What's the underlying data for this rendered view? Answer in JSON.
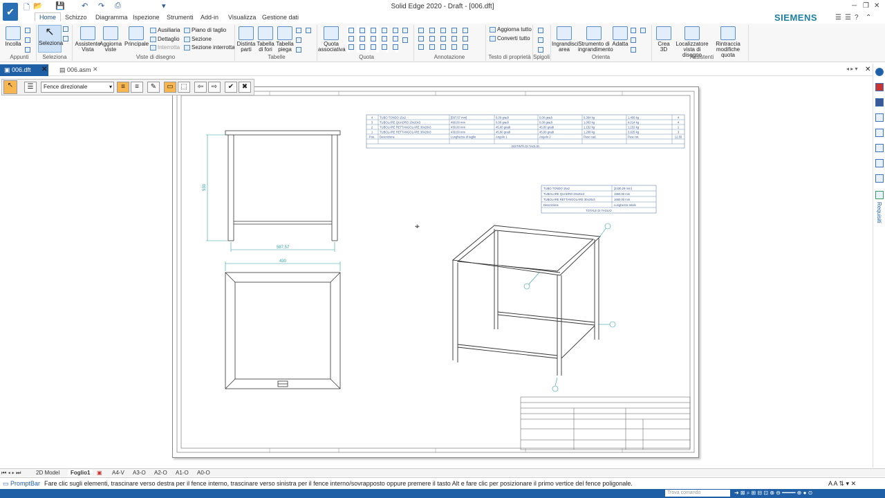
{
  "window": {
    "title": "Solid Edge 2020 - Draft - [006.dft]"
  },
  "ribbon_tabs": [
    "Home",
    "Schizzo",
    "Diagramma",
    "Ispezione",
    "Strumenti",
    "Add-in",
    "Visualizza",
    "Gestione dati"
  ],
  "brand": "SIEMENS",
  "ribbon": {
    "incolla": "Incolla",
    "seleziona": "Seleziona",
    "assistente_vista": "Assistente Vista",
    "aggiorna_viste": "Aggiorna viste",
    "principale": "Principale",
    "ausiliaria": "Ausiliaria",
    "dettaglio": "Dettaglio",
    "interrotta": "Interrotta",
    "piano_di_taglio": "Piano di taglio",
    "sezione": "Sezione",
    "sezione_interrotta": "Sezione interrotta",
    "distinta_parti": "Distinta parti",
    "tabella_di_fori": "Tabella di fori",
    "tabella_piega": "Tabella piega",
    "quota_associativa": "Quota associativa",
    "aggiorna_tutto": "Aggiorna tutto",
    "converti_tutto": "Converti tutto",
    "ingrandisci_area": "Ingrandisci area",
    "strumento_ingrandimento": "Strumento di ingrandimento",
    "adatta": "Adatta",
    "crea_3d": "Crea 3D",
    "localizzatore": "Localizzatore vista di disegno",
    "rintraccia": "Rintraccia modifiche quota",
    "groups": [
      "Appunti",
      "Seleziona",
      "Viste di disegno",
      "Tabelle",
      "Quota",
      "Annotazione",
      "Testo di proprietà",
      "Spigoli",
      "Orienta",
      "Assistenti"
    ]
  },
  "doc_tabs": [
    "006.dft",
    "006.asm"
  ],
  "command_bar": {
    "fence_option": "Fence direzionale"
  },
  "right_panel": {
    "label": "Requisiti"
  },
  "sheet_tabs": [
    "2D Model",
    "Foglio1",
    "A4-V",
    "A3-O",
    "A2-O",
    "A1-O",
    "A0-O"
  ],
  "prompt": {
    "label": "PromptBar",
    "text": "Fare clic sugli elementi, trascinare verso destra per il fence interno, trascinare verso sinistra per il fence interno/sovrapposto oppure premere il tasto Alt e fare clic per posizionare il primo vertice del fence poligonale."
  },
  "status": {
    "search_placeholder": "Trova comando"
  },
  "drawing": {
    "cut_table_1": {
      "rows": [
        [
          "4",
          "TUBO TONDO 15x2",
          "[587,57 mm]",
          "0,00 gradi",
          "0,00 gradi",
          "0,364 kg",
          "1,456 kg",
          "4"
        ],
        [
          "3",
          "TUBOLARE QUADRO 20x20x3",
          "490,00 mm",
          "0,00 gradi",
          "0,00 gradi",
          "1,003 kg",
          "4,014 kg",
          "4"
        ],
        [
          "2",
          "TUBOLARE RETTANGOLARE 30x20x3",
          "430,00 mm",
          "45,00 gradi",
          "45,00 gradi",
          "1,152 kg",
          "1,152 kg",
          "1"
        ],
        [
          "1",
          "TUBOLARE RETTANGOLARE 30x20x3",
          "430,00 mm",
          "45,00 gradi",
          "45,00 gradi",
          "1,208 kg",
          "3,625 kg",
          "3"
        ],
        [
          "Pos.",
          "Descrizione",
          "Lunghezza di taglio",
          "Angolo 1",
          "Angolo 2",
          "Peso cad.",
          "Peso tot.",
          "12,55"
        ]
      ],
      "caption": "DISTINTA DI TAGLIO"
    },
    "cut_table_2": {
      "rows": [
        [
          "TUBO TONDO 15x2",
          "[2430,29 mm]"
        ],
        [
          "TUBOLARE QUADRO 20x20x3",
          "1960,00 mm"
        ],
        [
          "TUBOLARE RETTANGOLARE 30x20x3",
          "1680,00 mm"
        ],
        [
          "Descrizione",
          "Lunghezza totale"
        ]
      ],
      "caption": "TOTALE DI TAGLIO"
    },
    "dims": {
      "height": "530",
      "width_bottom": "587,57",
      "width_top": "430"
    }
  }
}
